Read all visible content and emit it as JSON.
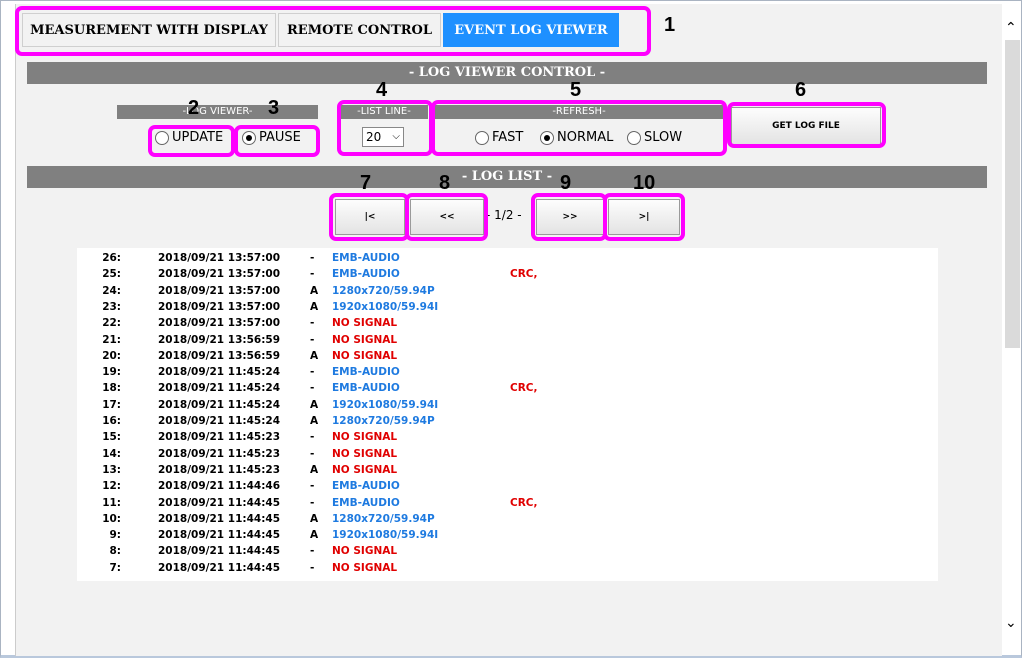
{
  "tabs": [
    "MEASUREMENT WITH DISPLAY",
    "REMOTE CONTROL",
    "EVENT LOG VIEWER"
  ],
  "callouts": [
    "1",
    "2",
    "3",
    "4",
    "5",
    "6",
    "7",
    "8",
    "9",
    "10"
  ],
  "control": {
    "section_title": "- LOG VIEWER CONTROL -",
    "log_viewer_label": "-LOG VIEWER-",
    "update_label": "UPDATE",
    "pause_label": "PAUSE",
    "list_line_label": "-LIST LINE-",
    "list_line_value": "20",
    "refresh_label": "-REFRESH-",
    "fast_label": "FAST",
    "normal_label": "NORMAL",
    "slow_label": "SLOW",
    "get_log_file_label": "GET LOG FILE"
  },
  "log": {
    "section_title": "- LOG LIST -",
    "first_label": "|<",
    "prev_label": "<<",
    "page_text": "- 1/2 -",
    "next_label": ">>",
    "last_label": ">|",
    "rows": [
      {
        "no": "26:",
        "dt": "2018/09/21 13:57:00",
        "flag": "-",
        "event": "EMB-AUDIO",
        "err": ""
      },
      {
        "no": "25:",
        "dt": "2018/09/21 13:57:00",
        "flag": "-",
        "event": "EMB-AUDIO",
        "err": "CRC,"
      },
      {
        "no": "24:",
        "dt": "2018/09/21 13:57:00",
        "flag": "A",
        "event": "1280x720/59.94P",
        "err": ""
      },
      {
        "no": "23:",
        "dt": "2018/09/21 13:57:00",
        "flag": "A",
        "event": "1920x1080/59.94I",
        "err": ""
      },
      {
        "no": "22:",
        "dt": "2018/09/21 13:57:00",
        "flag": "-",
        "event": "NO SIGNAL",
        "err": ""
      },
      {
        "no": "21:",
        "dt": "2018/09/21 13:56:59",
        "flag": "-",
        "event": "NO SIGNAL",
        "err": ""
      },
      {
        "no": "20:",
        "dt": "2018/09/21 13:56:59",
        "flag": "A",
        "event": "NO SIGNAL",
        "err": ""
      },
      {
        "no": "19:",
        "dt": "2018/09/21 11:45:24",
        "flag": "-",
        "event": "EMB-AUDIO",
        "err": ""
      },
      {
        "no": "18:",
        "dt": "2018/09/21 11:45:24",
        "flag": "-",
        "event": "EMB-AUDIO",
        "err": "CRC,"
      },
      {
        "no": "17:",
        "dt": "2018/09/21 11:45:24",
        "flag": "A",
        "event": "1920x1080/59.94I",
        "err": ""
      },
      {
        "no": "16:",
        "dt": "2018/09/21 11:45:24",
        "flag": "A",
        "event": "1280x720/59.94P",
        "err": ""
      },
      {
        "no": "15:",
        "dt": "2018/09/21 11:45:23",
        "flag": "-",
        "event": "NO SIGNAL",
        "err": ""
      },
      {
        "no": "14:",
        "dt": "2018/09/21 11:45:23",
        "flag": "-",
        "event": "NO SIGNAL",
        "err": ""
      },
      {
        "no": "13:",
        "dt": "2018/09/21 11:45:23",
        "flag": "A",
        "event": "NO SIGNAL",
        "err": ""
      },
      {
        "no": "12:",
        "dt": "2018/09/21 11:44:46",
        "flag": "-",
        "event": "EMB-AUDIO",
        "err": ""
      },
      {
        "no": "11:",
        "dt": "2018/09/21 11:44:45",
        "flag": "-",
        "event": "EMB-AUDIO",
        "err": "CRC,"
      },
      {
        "no": "10:",
        "dt": "2018/09/21 11:44:45",
        "flag": "A",
        "event": "1280x720/59.94P",
        "err": ""
      },
      {
        "no": "9:",
        "dt": "2018/09/21 11:44:45",
        "flag": "A",
        "event": "1920x1080/59.94I",
        "err": ""
      },
      {
        "no": "8:",
        "dt": "2018/09/21 11:44:45",
        "flag": "-",
        "event": "NO SIGNAL",
        "err": ""
      },
      {
        "no": "7:",
        "dt": "2018/09/21 11:44:45",
        "flag": "-",
        "event": "NO SIGNAL",
        "err": ""
      }
    ]
  },
  "colors": {
    "accent": "#1e90ff",
    "callout": "#ff00ff",
    "section_bar": "#808080",
    "event_blue": "#1e7ae0",
    "event_red": "#e00000"
  },
  "icons": {
    "scroll_up": "chevron-up-icon",
    "scroll_down": "chevron-down-icon"
  }
}
